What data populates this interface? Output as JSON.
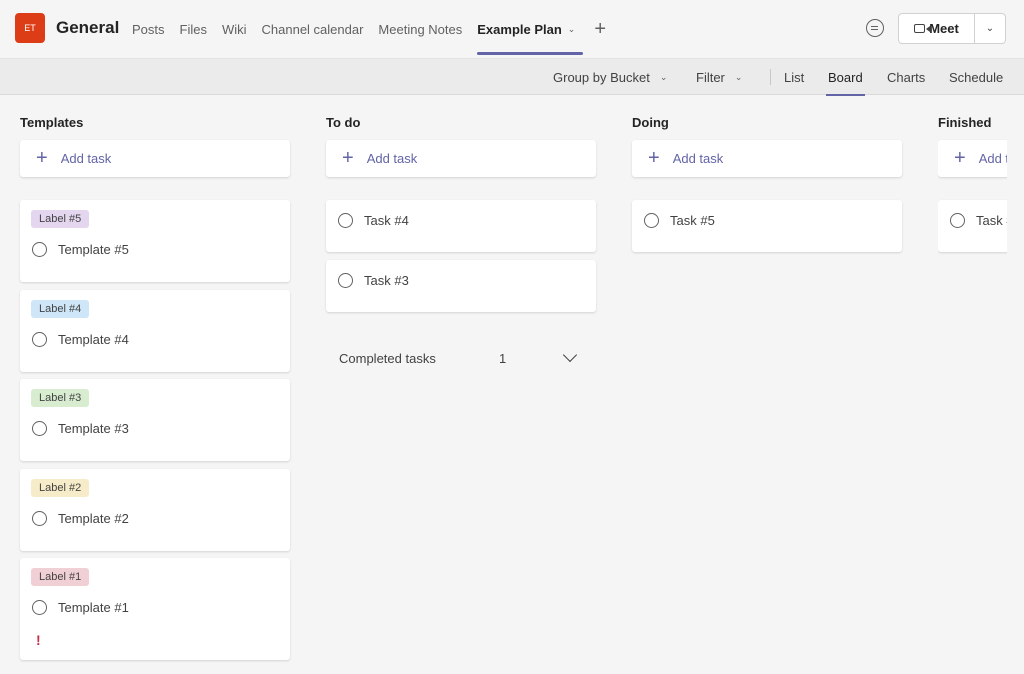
{
  "header": {
    "team_avatar": "ET",
    "channel_name": "General",
    "tabs": [
      {
        "label": "Posts"
      },
      {
        "label": "Files"
      },
      {
        "label": "Wiki"
      },
      {
        "label": "Channel calendar"
      },
      {
        "label": "Meeting Notes"
      },
      {
        "label": "Example Plan",
        "active": true
      }
    ],
    "meet_label": "Meet"
  },
  "toolbar": {
    "group_by": "Group by Bucket",
    "filter": "Filter",
    "views": [
      {
        "label": "List"
      },
      {
        "label": "Board",
        "active": true
      },
      {
        "label": "Charts"
      },
      {
        "label": "Schedule"
      }
    ]
  },
  "board": {
    "add_task_label": "Add task",
    "buckets": [
      {
        "title": "Templates",
        "cards": [
          {
            "label": "Label #5",
            "label_color": "#e3d6ee",
            "task": "Template #5"
          },
          {
            "label": "Label #4",
            "label_color": "#cfe6f8",
            "task": "Template #4"
          },
          {
            "label": "Label #3",
            "label_color": "#d8ecd0",
            "task": "Template #3"
          },
          {
            "label": "Label #2",
            "label_color": "#f7ecc9",
            "task": "Template #2"
          },
          {
            "label": "Label #1",
            "label_color": "#f1d0d5",
            "task": "Template #1",
            "urgent": "!"
          }
        ]
      },
      {
        "title": "To do",
        "cards": [
          {
            "task": "Task #4"
          },
          {
            "task": "Task #3"
          }
        ],
        "completed_label": "Completed tasks",
        "completed_count": "1"
      },
      {
        "title": "Doing",
        "cards": [
          {
            "task": "Task #5"
          }
        ]
      },
      {
        "title": "Finished",
        "cards": [
          {
            "task": "Task #"
          }
        ]
      }
    ]
  }
}
